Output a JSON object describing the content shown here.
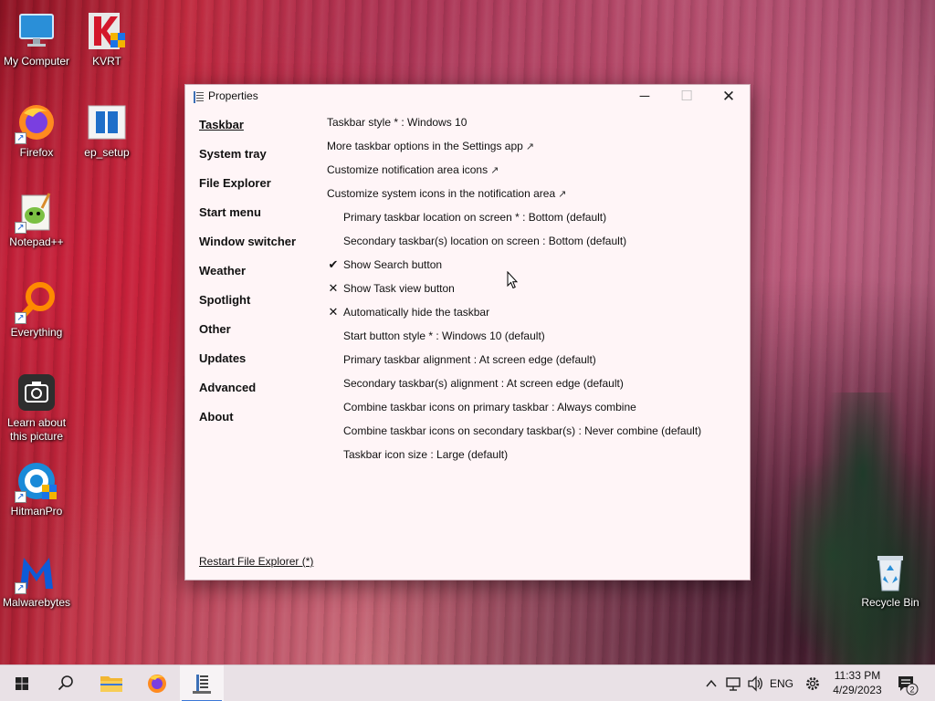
{
  "desktop": {
    "icons": [
      {
        "label": "My Computer"
      },
      {
        "label": "KVRT"
      },
      {
        "label": "Firefox"
      },
      {
        "label": "ep_setup"
      },
      {
        "label": "Notepad++"
      },
      {
        "label": "Everything"
      },
      {
        "label": "Learn about this picture"
      },
      {
        "label": "HitmanPro"
      },
      {
        "label": "Malwarebytes"
      },
      {
        "label": "Recycle Bin"
      }
    ]
  },
  "window": {
    "title": "Properties",
    "minimize_glyph": "─",
    "maximize_glyph": "☐",
    "close_glyph": "✕",
    "nav": [
      {
        "label": "Taskbar",
        "active": true
      },
      {
        "label": "System tray"
      },
      {
        "label": "File Explorer"
      },
      {
        "label": "Start menu"
      },
      {
        "label": "Window switcher"
      },
      {
        "label": "Weather"
      },
      {
        "label": "Spotlight"
      },
      {
        "label": "Other"
      },
      {
        "label": "Updates"
      },
      {
        "label": "Advanced"
      },
      {
        "label": "About"
      }
    ],
    "options": [
      {
        "text": "Taskbar style * : Windows 10"
      },
      {
        "text": "More taskbar options in the Settings app",
        "ext": "↗"
      },
      {
        "text": "Customize notification area icons",
        "ext": "↗"
      },
      {
        "text": "Customize system icons in the notification area",
        "ext": "↗"
      },
      {
        "text": "Primary taskbar location on screen * : Bottom (default)"
      },
      {
        "text": "Secondary taskbar(s) location on screen : Bottom (default)"
      },
      {
        "text": "Show Search button",
        "mark": "✔"
      },
      {
        "text": "Show Task view button",
        "mark": "✕"
      },
      {
        "text": "Automatically hide the taskbar",
        "mark": "✕"
      },
      {
        "text": "Start button style * : Windows 10 (default)"
      },
      {
        "text": "Primary taskbar alignment : At screen edge (default)"
      },
      {
        "text": "Secondary taskbar(s) alignment : At screen edge (default)"
      },
      {
        "text": "Combine taskbar icons on primary taskbar : Always combine"
      },
      {
        "text": "Combine taskbar icons on secondary taskbar(s) : Never combine (default)"
      },
      {
        "text": "Taskbar icon size : Large (default)"
      }
    ],
    "restart_label": "Restart File Explorer (*)"
  },
  "taskbar": {
    "tray_chevron": "^",
    "language": "ENG",
    "time": "11:33 PM",
    "date": "4/29/2023",
    "notification_count": "2"
  },
  "colors": {
    "accent": "#3b78d8",
    "window_bg": "#fff5f7",
    "taskbar_bg": "#e9e1e6"
  }
}
